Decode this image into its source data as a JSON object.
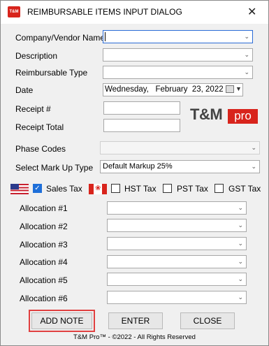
{
  "window": {
    "title": "REIMBURSABLE ITEMS INPUT DIALOG",
    "app_icon_text": "T&M",
    "close_glyph": "✕"
  },
  "form": {
    "company_label": "Company/Vendor Name",
    "company_value": "",
    "description_label": "Description",
    "description_value": "",
    "type_label": "Reimbursable Type",
    "type_value": "",
    "date_label": "Date",
    "date_value": "Wednesday,   February  23, 2022",
    "receipt_no_label": "Receipt #",
    "receipt_no_value": "",
    "receipt_total_label": "Receipt Total",
    "receipt_total_value": "",
    "phase_label": "Phase Codes",
    "phase_value": "",
    "markup_label": "Select Mark Up Type",
    "markup_value": "Default Markup 25%"
  },
  "logo": {
    "tm": "T&M",
    "pro": "pro"
  },
  "taxes": {
    "sales_label": "Sales Tax",
    "sales_checked": true,
    "hst_label": "HST Tax",
    "hst_checked": false,
    "pst_label": "PST Tax",
    "pst_checked": false,
    "gst_label": "GST Tax",
    "gst_checked": false
  },
  "allocations": [
    {
      "label": "Allocation #1",
      "value": ""
    },
    {
      "label": "Allocation #2",
      "value": ""
    },
    {
      "label": "Allocation #3",
      "value": ""
    },
    {
      "label": "Allocation #4",
      "value": ""
    },
    {
      "label": "Allocation #5",
      "value": ""
    },
    {
      "label": "Allocation #6",
      "value": ""
    }
  ],
  "buttons": {
    "add_note": "ADD NOTE",
    "enter": "ENTER",
    "close": "CLOSE"
  },
  "colors": {
    "highlight": "#e04040",
    "brand_red": "#d8241c",
    "checkbox_blue": "#1e6fd9"
  },
  "footer": "T&M Pro™ - ©2022 - All Rights Reserved"
}
